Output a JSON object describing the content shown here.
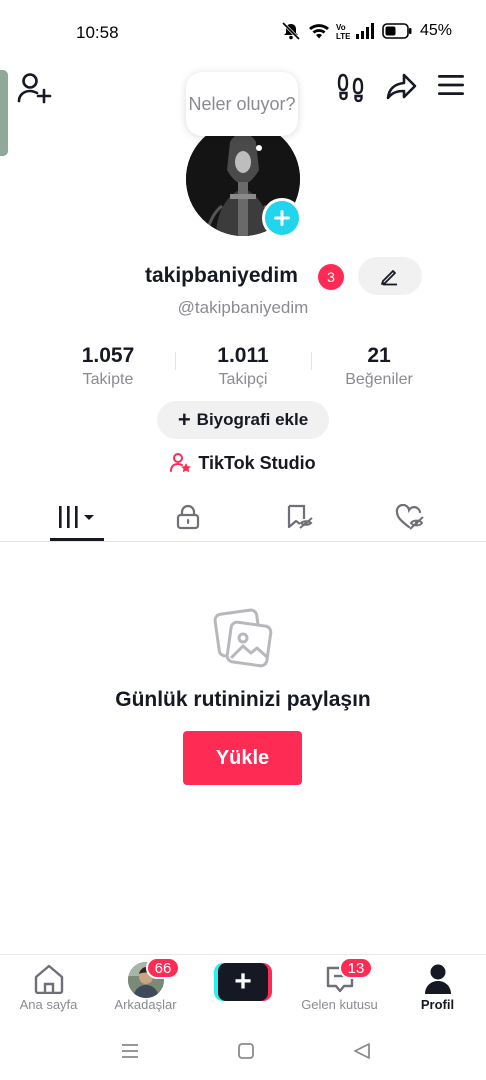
{
  "status_bar": {
    "time": "10:58",
    "battery_percent": "45%",
    "icons": [
      "mute-icon",
      "wifi-icon",
      "volte-icon",
      "signal-icon",
      "battery-icon"
    ]
  },
  "header": {
    "note_bubble": "Neler oluyor?",
    "icons": [
      "add-friend-icon",
      "footprint-icon",
      "share-icon",
      "menu-icon"
    ]
  },
  "profile": {
    "username": "takipbaniyedim",
    "username_badge": "3",
    "handle": "@takipbaniyedim",
    "stats": [
      {
        "value": "1.057",
        "label": "Takipte"
      },
      {
        "value": "1.011",
        "label": "Takipçi"
      },
      {
        "value": "21",
        "label": "Beğeniler"
      }
    ],
    "bio_button": "Biyografi ekle",
    "studio_label": "TikTok Studio"
  },
  "tabs": [
    {
      "icon": "videos-grid-icon",
      "active": true
    },
    {
      "icon": "lock-icon",
      "active": false
    },
    {
      "icon": "favorites-icon",
      "active": false
    },
    {
      "icon": "liked-icon",
      "active": false
    }
  ],
  "empty_state": {
    "icon": "photos-icon",
    "title": "Günlük rutininizi paylaşın",
    "button": "Yükle"
  },
  "bottom_nav": {
    "items": [
      {
        "label": "Ana sayfa",
        "icon": "home-icon",
        "badge": ""
      },
      {
        "label": "Arkadaşlar",
        "icon": "friends-avatar",
        "badge": "66"
      },
      {
        "label": "",
        "icon": "create-plus-icon",
        "badge": ""
      },
      {
        "label": "Gelen kutusu",
        "icon": "inbox-icon",
        "badge": "13"
      },
      {
        "label": "Profil",
        "icon": "profile-icon",
        "badge": ""
      }
    ]
  },
  "colors": {
    "accent": "#fe2c55",
    "cyan": "#20d5ec",
    "text": "#161823",
    "muted": "#8a8b91"
  }
}
